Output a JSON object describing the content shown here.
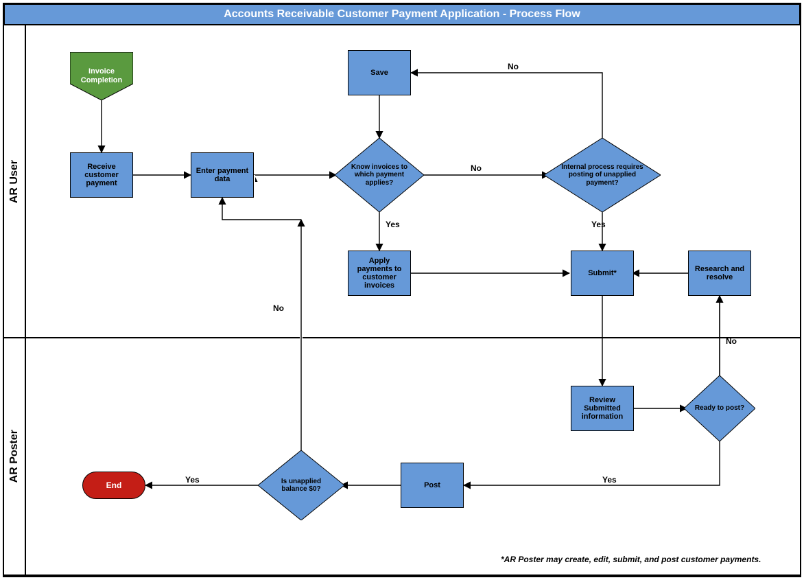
{
  "title": "Accounts Receivable Customer Payment Application - Process Flow",
  "lanes": {
    "user": "AR User",
    "poster": "AR Poster"
  },
  "nodes": {
    "start": "Invoice\nCompletion",
    "receive": "Receive customer payment",
    "enter": "Enter payment data",
    "save": "Save",
    "know": "Know invoices to which payment applies?",
    "internal": "Internal process requires posting of unapplied payment?",
    "apply": "Apply payments to customer invoices",
    "submit": "Submit*",
    "research": "Research and resolve",
    "review": "Review Submitted information",
    "ready": "Ready to post?",
    "post": "Post",
    "unapplied": "Is unapplied balance $0?",
    "end": "End"
  },
  "labels": {
    "yes": "Yes",
    "no": "No"
  },
  "footnote": "*AR Poster may create, edit, submit, and post customer payments."
}
